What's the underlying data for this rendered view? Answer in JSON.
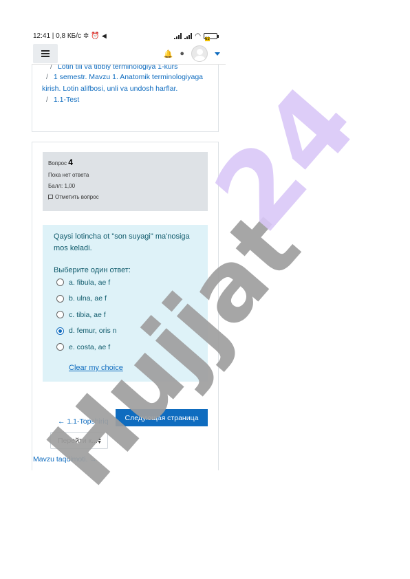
{
  "status_bar": {
    "time_speed": "12:41 | 0,8 КБ/с",
    "battery": "63"
  },
  "navbar": {
    "menu_icon": "hamburger-icon",
    "notifications_icon": "bell-icon",
    "messages_icon": "chat-icon",
    "user_menu_icon": "chevron-down-icon"
  },
  "breadcrumbs": [
    "Lotin tili va tibbiy terminologiya 1-kurs",
    "1 semestr. Mavzu 1. Anatomik terminologiyaga kirish. Lotin alifbosi, unli va undosh harflar.",
    "1.1-Test"
  ],
  "question_info": {
    "label": "Вопрос",
    "number": "4",
    "state": "Пока нет ответа",
    "mark": "Балл: 1,00",
    "flag_label": "Отметить вопрос"
  },
  "question": {
    "text": "Qaysi lotincha ot \"son suyagi\" ma'nosiga mos keladi.",
    "prompt": "Выберите один ответ:",
    "options": [
      {
        "label": "a. fibula, ae f",
        "selected": false
      },
      {
        "label": "b. ulna, ae f",
        "selected": false
      },
      {
        "label": "c. tibia, ae f",
        "selected": false
      },
      {
        "label": "d. femur, oris n",
        "selected": true
      },
      {
        "label": "e. costa, ae f",
        "selected": false
      }
    ],
    "clear_label": "Clear my choice"
  },
  "navigation": {
    "prev_activity": "← 1.1-Topshiriq",
    "next_page": "Следующая страница",
    "jump_label": "Перейти к...",
    "next_activity": "Mavzu taqdimoti. →"
  },
  "watermark": {
    "text": "Hujjat 24",
    "colors": {
      "hujjat": "#9e9e9e",
      "number": "#d9c8f7"
    }
  },
  "colors": {
    "link": "#0f6cbf",
    "info_bg": "#dee2e6",
    "question_bg": "#def2f8",
    "primary_button": "#0f6cbf"
  }
}
